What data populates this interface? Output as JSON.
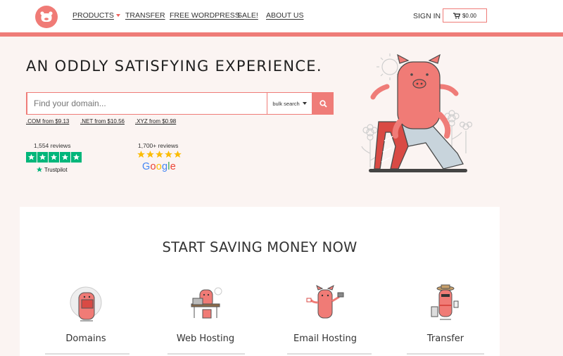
{
  "nav": {
    "items": [
      "PRODUCTS",
      "TRANSFER",
      "FREE WORDPRESS",
      "SALE!",
      "ABOUT US"
    ],
    "signin": "SIGN IN",
    "cart_total": "$0.00"
  },
  "hero": {
    "title": "AN ODDLY SATISFYING EXPERIENCE.",
    "search_placeholder": "Find your domain...",
    "bulk_label": "bulk search",
    "tlds": [
      ".COM from $9.13",
      ".NET from $10.56",
      ".XYZ from $0.98"
    ],
    "trustpilot_reviews": "1,554 reviews",
    "trustpilot_brand": "Trustpilot",
    "google_reviews": "1,700+ reviews",
    "google_brand": "Google"
  },
  "savings": {
    "title": "START SAVING MONEY NOW",
    "features": [
      "Domains",
      "Web Hosting",
      "Email Hosting",
      "Transfer"
    ]
  },
  "colors": {
    "brand": "#ef7c78",
    "trustpilot": "#00b67a",
    "google_star": "#fbbc05"
  },
  "icons": [
    "logo-pig-icon",
    "cart-icon",
    "search-icon",
    "star-icon",
    "pig-slide-illustration"
  ]
}
